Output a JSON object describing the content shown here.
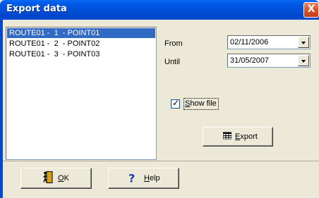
{
  "window": {
    "title": "Export data",
    "close_glyph": "X"
  },
  "list": {
    "items": [
      {
        "label": "ROUTE01 -  1  - POINT01",
        "selected": true
      },
      {
        "label": "ROUTE01 -  2  - POINT02",
        "selected": false
      },
      {
        "label": "ROUTE01 -  3  - POINT03",
        "selected": false
      }
    ]
  },
  "range": {
    "from_label": "From",
    "from_value": "02/11/2006",
    "until_label": "Until",
    "until_value": "31/05/2007"
  },
  "show_file": {
    "label": "Show file",
    "checked": true
  },
  "buttons": {
    "export_label": "Export",
    "export_icon": "table-icon",
    "ok_label": "OK",
    "ok_icon": "door-exit-icon",
    "help_label": "Help",
    "help_icon": "question-mark-icon"
  },
  "colors": {
    "title_bar": "#0250d8",
    "selection": "#316ac5",
    "close_button": "#d4532a",
    "dialog_face": "#ece9d8"
  }
}
